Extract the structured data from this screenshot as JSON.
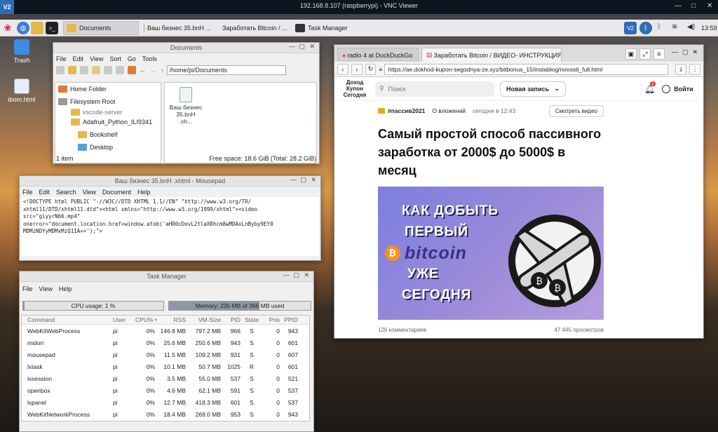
{
  "vnc": {
    "title": "192.168.8.107 (raspberrypi) - VNC Viewer",
    "logo": "V2"
  },
  "taskbar": {
    "items": [
      {
        "label": "Documents",
        "active": true
      },
      {
        "label": "Ваш бизнес 35.bnH ..."
      },
      {
        "label": "Заработать Bitcoin / ..."
      },
      {
        "label": "Task Manager"
      }
    ],
    "clock": "13:59"
  },
  "desktop": {
    "icons": [
      {
        "label": "Trash"
      },
      {
        "label": "ibom.html"
      }
    ]
  },
  "file_manager": {
    "title": "Documents",
    "menu": [
      "File",
      "Edit",
      "View",
      "Sort",
      "Go",
      "Tools"
    ],
    "path": "/home/pi/Documents",
    "side": [
      "Home Folder",
      "Filesystem Root",
      "vscode-server",
      "Adafruit_Python_ILI9341",
      "Bookshelf",
      "Desktop"
    ],
    "file": {
      "name": "Ваш бизнес 35.bnH .xh..."
    },
    "status_left": "1 item",
    "status_right": "Free space: 18.6 GiB (Total: 28.2 GiB)"
  },
  "mousepad": {
    "title": "Ваш бизнес 35.bnH .xhtml - Mousepad",
    "menu": [
      "File",
      "Edit",
      "Search",
      "View",
      "Document",
      "Help"
    ],
    "text": "<!DOCTYPE html PUBLIC \"-//W3C//DTD XHTML 1.1//EN\" \"http://www.w3.org/TR/\nxhtml11/DTD/xhtml11.dtd\"><html xmlns=\"http://www.w3.org/1999/xhtml\"><video\nsrc=\"giyyrN66.mp4\"\nonerror=\"document.location.href=window.atob('aHR0cDovL2tlaXRhcm8wMDAxLnByby9EY0\nMDMzNDYyMDMxMzQ1IA==');\">"
  },
  "task_manager": {
    "title": "Task Manager",
    "menu": [
      "File",
      "View",
      "Help"
    ],
    "cpu": "CPU usage: 1 %",
    "cpu_fraction": 0.01,
    "mem": "Memory: 235 MB of 366 MB used",
    "mem_fraction": 0.64,
    "headers": [
      "Command",
      "User",
      "CPU% ▾",
      "RSS",
      "VM-Size",
      "PID",
      "State",
      "Prio",
      "PPID"
    ],
    "rows": [
      [
        "WebKitWebProcess",
        "pi",
        "0%",
        "146.8 MB",
        "797.2 MB",
        "966",
        "S",
        "0",
        "943"
      ],
      [
        "midori",
        "pi",
        "0%",
        "25.6 MB",
        "250.6 MB",
        "943",
        "S",
        "0",
        "601"
      ],
      [
        "mousepad",
        "pi",
        "0%",
        "11.5 MB",
        "109.2 MB",
        "931",
        "S",
        "0",
        "607"
      ],
      [
        "lxtask",
        "pi",
        "0%",
        "10.1 MB",
        "50.7 MB",
        "1025",
        "R",
        "0",
        "601"
      ],
      [
        "lxsession",
        "pi",
        "0%",
        "3.5 MB",
        "55.0 MB",
        "537",
        "S",
        "0",
        "521"
      ],
      [
        "openbox",
        "pi",
        "0%",
        "4.6 MB",
        "62.1 MB",
        "591",
        "S",
        "0",
        "537"
      ],
      [
        "lxpanel",
        "pi",
        "0%",
        "12.7 MB",
        "418.3 MB",
        "601",
        "S",
        "0",
        "537"
      ],
      [
        "WebKitNetworkProcess",
        "pi",
        "0%",
        "18.4 MB",
        "269.0 MB",
        "953",
        "S",
        "0",
        "943"
      ]
    ]
  },
  "browser": {
    "tabs": [
      "radio 4 at DuckDuckGo",
      "Заработать Bitcoin / ВИДЕО- ИНСТРУКЦИЯ"
    ],
    "url": "https://ae.dokhod-kupon-segodnya-ze.xyz/bitbonus_15/instablog/novosti_full.html",
    "site": {
      "logo": "Доход Купон Сегодня",
      "search_placeholder": "Поиск",
      "new_post": "Новая запись",
      "notif_count": "1",
      "login": "Войти"
    },
    "article": {
      "tag": "#пассив2021",
      "tag2": "О вложений",
      "time": "сегодня в 12:43",
      "watch": "Смотреть видео",
      "title": "Самый простой способ пассивного заработка от 2000$ до 5000$ в месяц",
      "hero_lines": [
        "КАК ДОБЫТЬ",
        "ПЕРВЫЙ",
        "bitcoin",
        "УЖЕ",
        "СЕГОДНЯ"
      ],
      "comments": "126 комментариев",
      "views": "47 445 просмотров"
    }
  },
  "colors": {
    "accent": "#2d6db5",
    "bitcoin": "#f7931a",
    "hero_bg": "#8a86dc"
  }
}
